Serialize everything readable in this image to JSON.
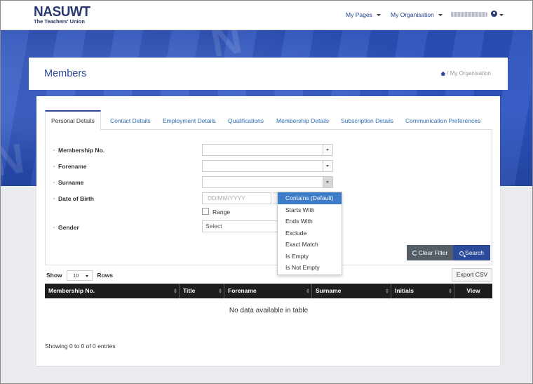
{
  "header": {
    "logo_main": "NASUWT",
    "logo_sub": "The Teachers' Union",
    "nav": [
      "My Pages",
      "My Organisation"
    ]
  },
  "page": {
    "title": "Members",
    "breadcrumb": "My Organisation"
  },
  "tabs": [
    "Personal Details",
    "Contact Details",
    "Employment Details",
    "Qualifications",
    "Membership Details",
    "Subscription Details",
    "Communication Preferences"
  ],
  "form": {
    "labels": {
      "membership_no": "Membership No.",
      "forename": "Forename",
      "surname": "Surname",
      "dob": "Date of Birth",
      "gender": "Gender"
    },
    "dob_placeholder": "DD/MM/YYYY",
    "range_label": "Range",
    "gender_placeholder": "Select",
    "clear_label": "Clear Filter",
    "search_label": "Search"
  },
  "dropdown": {
    "options": [
      "Contains (Default)",
      "Starts With",
      "Ends With",
      "Exclude",
      "Exact Match",
      "Is Empty",
      "Is Not Empty"
    ],
    "selected": "Contains (Default)"
  },
  "table": {
    "show_label": "Show",
    "rows_value": "10",
    "rows_label": "Rows",
    "export_label": "Export CSV",
    "columns": [
      "Membership No.",
      "Title",
      "Forename",
      "Surname",
      "Initials",
      "View"
    ],
    "empty_message": "No data available in table",
    "info": "Showing 0 to 0 of 0 entries"
  },
  "colors": {
    "brand": "#2b3a73",
    "accent": "#2b4a9a",
    "dropdown_selected": "#3d7cc9"
  }
}
